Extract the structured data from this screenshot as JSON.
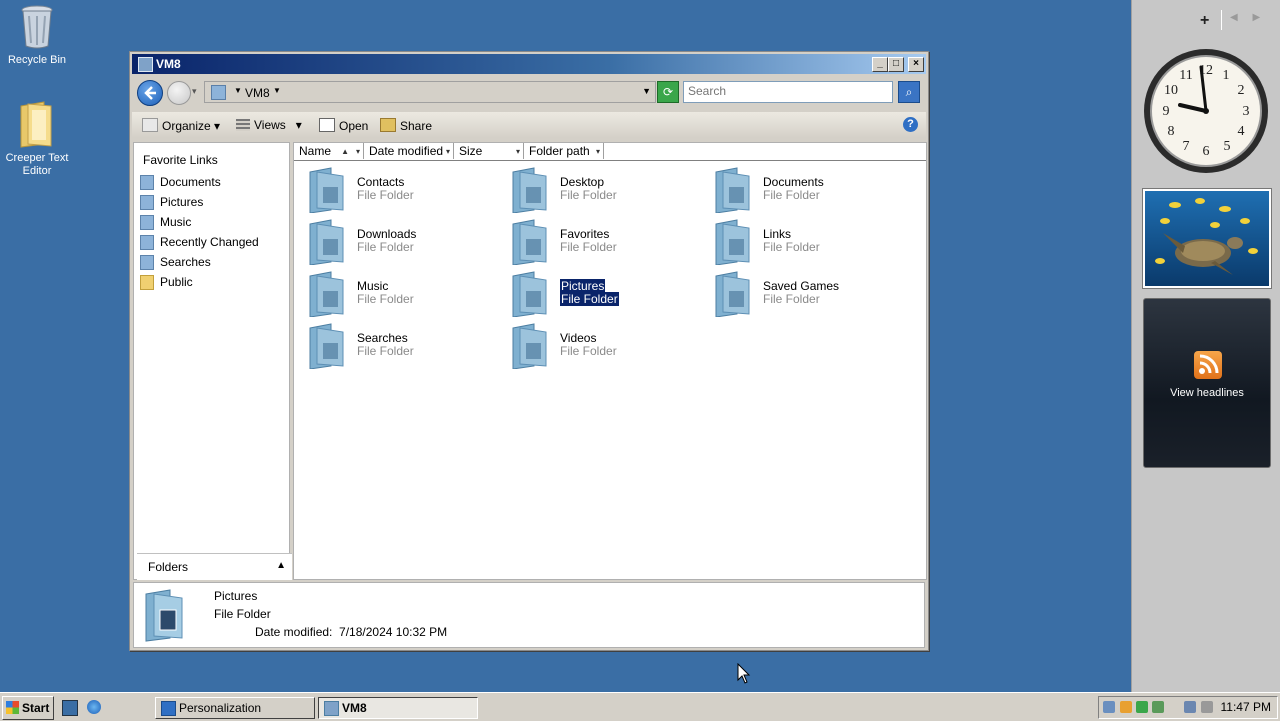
{
  "desktop": {
    "icons": [
      {
        "label": "Recycle Bin",
        "icon": "recycle-bin-icon"
      },
      {
        "label": "Creeper Text Editor",
        "icon": "folder-icon"
      }
    ]
  },
  "sidebar": {
    "add_label": "+",
    "nav_arrows": "◀ ▶",
    "clock": {
      "time": "11:47"
    },
    "feed": {
      "label": "View headlines"
    }
  },
  "window": {
    "title": "VM8",
    "address": {
      "crumb": "VM8"
    },
    "search": {
      "placeholder": "Search"
    },
    "toolbar": {
      "organize": "Organize",
      "views": "Views",
      "open": "Open",
      "share": "Share",
      "help": "?"
    },
    "nav_pane": {
      "header": "Favorite Links",
      "links": [
        {
          "label": "Documents",
          "icon": "documents-folder-icon"
        },
        {
          "label": "Pictures",
          "icon": "pictures-folder-icon"
        },
        {
          "label": "Music",
          "icon": "music-folder-icon"
        },
        {
          "label": "Recently Changed",
          "icon": "recent-icon"
        },
        {
          "label": "Searches",
          "icon": "search-folder-icon"
        },
        {
          "label": "Public",
          "icon": "public-folder-icon"
        }
      ],
      "folders_label": "Folders"
    },
    "columns": [
      "Name",
      "Date modified",
      "Size",
      "Folder path"
    ],
    "items": [
      {
        "name": "Contacts",
        "type": "File Folder",
        "icon": "contacts-folder-icon",
        "selected": false
      },
      {
        "name": "Desktop",
        "type": "File Folder",
        "icon": "desktop-folder-icon",
        "selected": false
      },
      {
        "name": "Documents",
        "type": "File Folder",
        "icon": "documents-folder-icon",
        "selected": false
      },
      {
        "name": "Downloads",
        "type": "File Folder",
        "icon": "downloads-folder-icon",
        "selected": false
      },
      {
        "name": "Favorites",
        "type": "File Folder",
        "icon": "favorites-folder-icon",
        "selected": false
      },
      {
        "name": "Links",
        "type": "File Folder",
        "icon": "links-folder-icon",
        "selected": false
      },
      {
        "name": "Music",
        "type": "File Folder",
        "icon": "music-folder-icon",
        "selected": false
      },
      {
        "name": "Pictures",
        "type": "File Folder",
        "icon": "pictures-folder-icon",
        "selected": true
      },
      {
        "name": "Saved Games",
        "type": "File Folder",
        "icon": "saved-games-folder-icon",
        "selected": false
      },
      {
        "name": "Searches",
        "type": "File Folder",
        "icon": "searches-folder-icon",
        "selected": false
      },
      {
        "name": "Videos",
        "type": "File Folder",
        "icon": "videos-folder-icon",
        "selected": false
      }
    ],
    "details": {
      "name": "Pictures",
      "type": "File Folder",
      "date_label": "Date modified:",
      "date_value": "7/18/2024 10:32 PM"
    }
  },
  "taskbar": {
    "start_label": "Start",
    "tasks": [
      {
        "label": "Personalization",
        "active": false
      },
      {
        "label": "VM8",
        "active": true
      }
    ],
    "clock": "11:47 PM"
  },
  "colors": {
    "desktop": "#3a6ea5",
    "selection": "#0a246a",
    "title_gradient_start": "#0a246a"
  }
}
